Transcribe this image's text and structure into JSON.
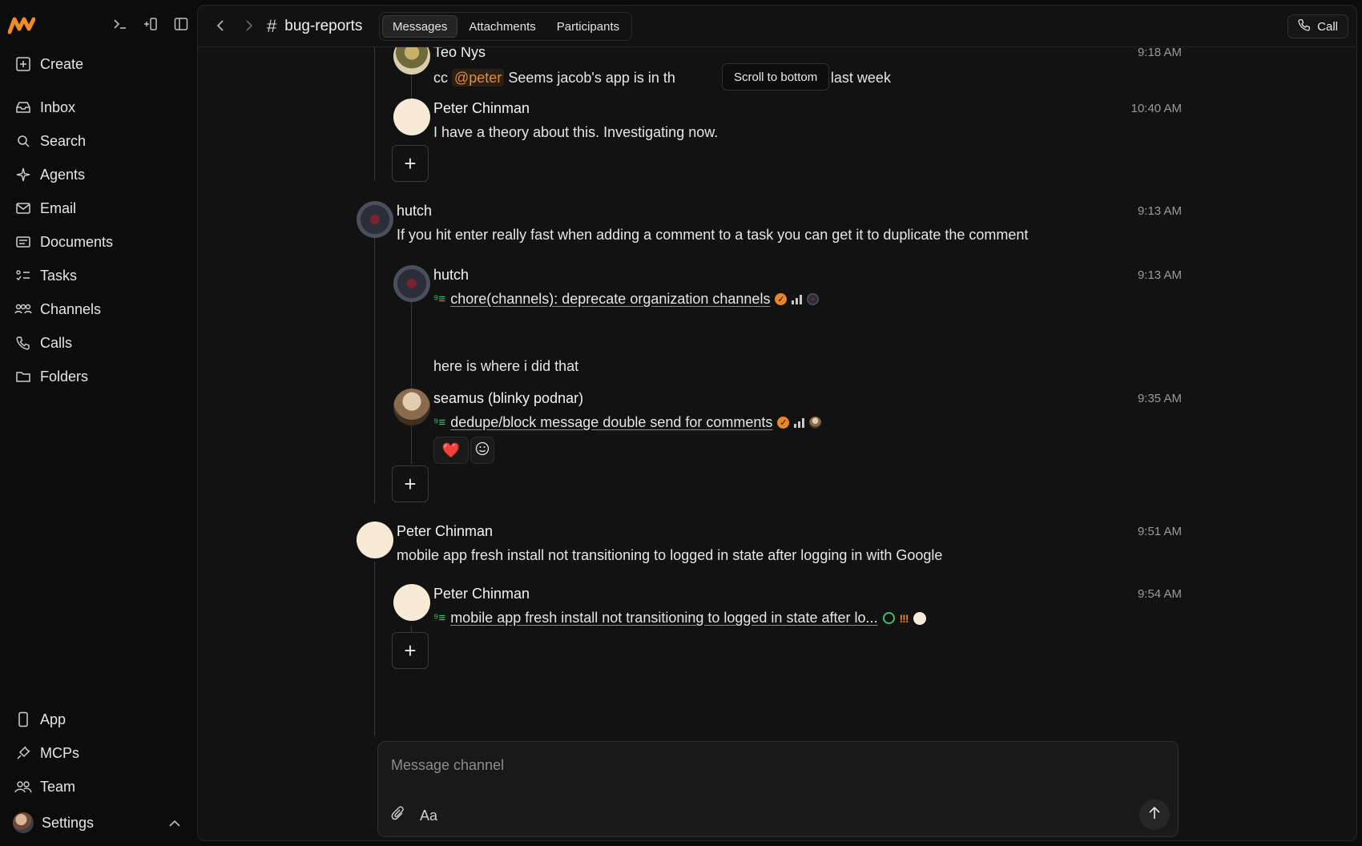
{
  "sidebar": {
    "create_label": "Create",
    "items": [
      {
        "label": "Inbox",
        "icon": "inbox-icon"
      },
      {
        "label": "Search",
        "icon": "search-icon"
      },
      {
        "label": "Agents",
        "icon": "sparkle-icon"
      },
      {
        "label": "Email",
        "icon": "mail-icon"
      },
      {
        "label": "Documents",
        "icon": "document-icon"
      },
      {
        "label": "Tasks",
        "icon": "tasks-icon"
      },
      {
        "label": "Channels",
        "icon": "channels-icon"
      },
      {
        "label": "Calls",
        "icon": "phone-icon"
      },
      {
        "label": "Folders",
        "icon": "folder-icon"
      }
    ],
    "bottom_items": [
      {
        "label": "App",
        "icon": "phone-device-icon"
      },
      {
        "label": "MCPs",
        "icon": "plug-icon"
      },
      {
        "label": "Team",
        "icon": "team-icon"
      }
    ],
    "settings_label": "Settings"
  },
  "header": {
    "channel_name": "bug-reports",
    "tabs": [
      "Messages",
      "Attachments",
      "Participants"
    ],
    "active_tab": "Messages",
    "call_label": "Call"
  },
  "tooltip": "Scroll to bottom",
  "messages": {
    "m1": {
      "author": "Teo Nys",
      "time": "9:18 AM",
      "prefix": "cc ",
      "mention": "@peter",
      "text_a": " Seems jacob's app is in th",
      "text_b": "e was last week"
    },
    "m2": {
      "author": "Peter Chinman",
      "time": "10:40 AM",
      "text": "I have a theory about this. Investigating now."
    },
    "m3": {
      "author": "hutch",
      "time": "9:13 AM",
      "text": "If you hit enter really fast when adding a comment to a task you can get it to duplicate the comment"
    },
    "m4": {
      "author": "hutch",
      "time": "9:13 AM",
      "task": "chore(channels): deprecate organization channels",
      "text": "here is where i did that"
    },
    "m5": {
      "author": "seamus (blinky podnar)",
      "time": "9:35 AM",
      "task": "dedupe/block message double send for comments",
      "reaction": "❤️"
    },
    "m6": {
      "author": "Peter Chinman",
      "time": "9:51 AM",
      "text": "mobile app fresh install not transitioning to logged in state after logging in with Google"
    },
    "m7": {
      "author": "Peter Chinman",
      "time": "9:54 AM",
      "task": "mobile app fresh install not transitioning to logged in state after lo...",
      "priority": "!!!"
    }
  },
  "composer": {
    "placeholder": "Message channel",
    "format_label": "Aa"
  },
  "colors": {
    "accent": "#e9862a",
    "mention": "#e08d3c",
    "task_green": "#3fbf6b"
  }
}
